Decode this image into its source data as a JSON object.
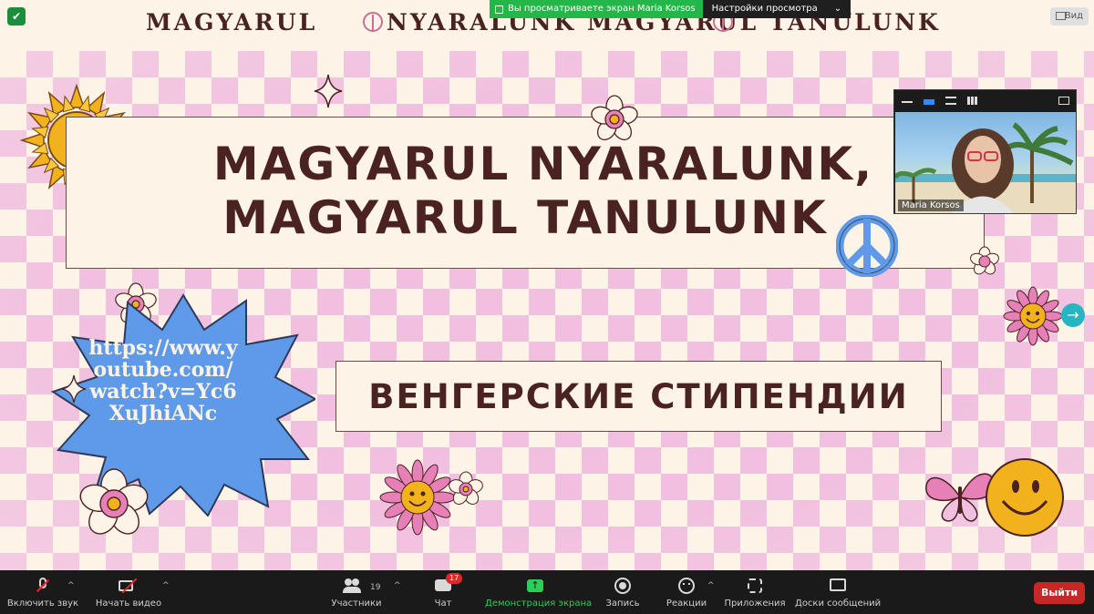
{
  "banner": {
    "left_text": "MAGYARUL",
    "right_text": "NYARALUNK MAGYARUL TANULUNK"
  },
  "share_bar": {
    "status": "Вы просматриваете экран Maria Korsos",
    "settings": "Настройки просмотра",
    "settings_chevron": "chevron-down-icon"
  },
  "view_button": {
    "label": "Вид"
  },
  "slide": {
    "title_line1": "MAGYARUL NYARALUNK,",
    "title_line2": "MAGYARUL TANULUNK",
    "subtitle": "ВЕНГЕРСКИЕ СТИПЕНДИИ",
    "url": "https://www.youtube.com/watch?v=Yc6XuJhiANc",
    "colors": {
      "pink": "#f1bfe0",
      "cream": "#fdf4e7",
      "brown": "#4a2222",
      "blue": "#5e9ae8",
      "sun": "#f2b21b"
    }
  },
  "video_tile": {
    "participant_name": "Maria Korsos",
    "toolbar_icons": [
      "minimize-icon",
      "speaker-view-icon",
      "split-view-icon",
      "gallery-view-icon",
      "exit-fullscreen-icon"
    ]
  },
  "toolbar": {
    "unmute": "Включить звук",
    "start_video": "Начать видео",
    "participants": "Участники",
    "participants_count": "19",
    "chat": "Чат",
    "chat_badge": "17",
    "share_screen": "Демонстрация экрана",
    "record": "Запись",
    "reactions": "Реакции",
    "apps": "Приложения",
    "whiteboards": "Доски сообщений",
    "leave": "Выйти",
    "share_color": "#2ecc59",
    "leave_color": "#c92626"
  }
}
